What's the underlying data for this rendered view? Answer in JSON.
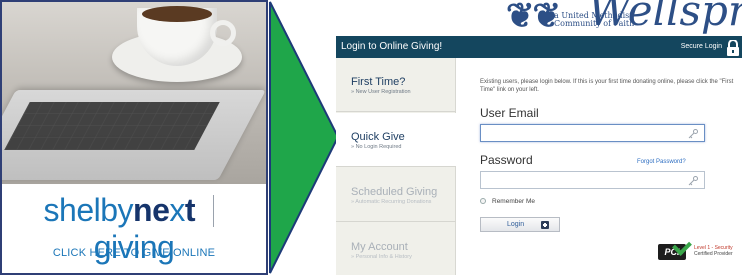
{
  "promo": {
    "brand_shelby": "shelby",
    "brand_next_ne": "ne",
    "brand_next_x": "x",
    "brand_next_t": "t",
    "brand_giving": "giving",
    "cta": "CLICK HERE TO GIVE ONLINE"
  },
  "header": {
    "logo_word": "Wellspring",
    "logo_tag_line1": "a United Methodist",
    "logo_tag_line2": "Community of Faith"
  },
  "topbar": {
    "title": "Login to Online Giving!",
    "secure": "Secure Login"
  },
  "nav": {
    "items": [
      {
        "title": "First Time?",
        "sub": "» New User Registration"
      },
      {
        "title": "Quick Give",
        "sub": "» No Login Required"
      },
      {
        "title": "Scheduled Giving",
        "sub": "» Automatic Recurring Donations"
      },
      {
        "title": "My Account",
        "sub": "» Personal Info & History"
      }
    ]
  },
  "login": {
    "intro": "Existing users, please login below. If this is your first time donating online, please click the \"First Time\" link on your left.",
    "email_label": "User Email",
    "email_value": "",
    "password_label": "Password",
    "password_value": "",
    "forgot": "Forgot Password?",
    "remember": "Remember Me",
    "login_button": "Login"
  },
  "pci": {
    "badge": "PCI",
    "line1": "Level 1 - Security",
    "line2": "Certified Provider"
  },
  "colors": {
    "topbar": "#14465e",
    "arrow": "#1fa64a",
    "brand_blue": "#1b76b8",
    "brand_navy": "#16346b"
  }
}
